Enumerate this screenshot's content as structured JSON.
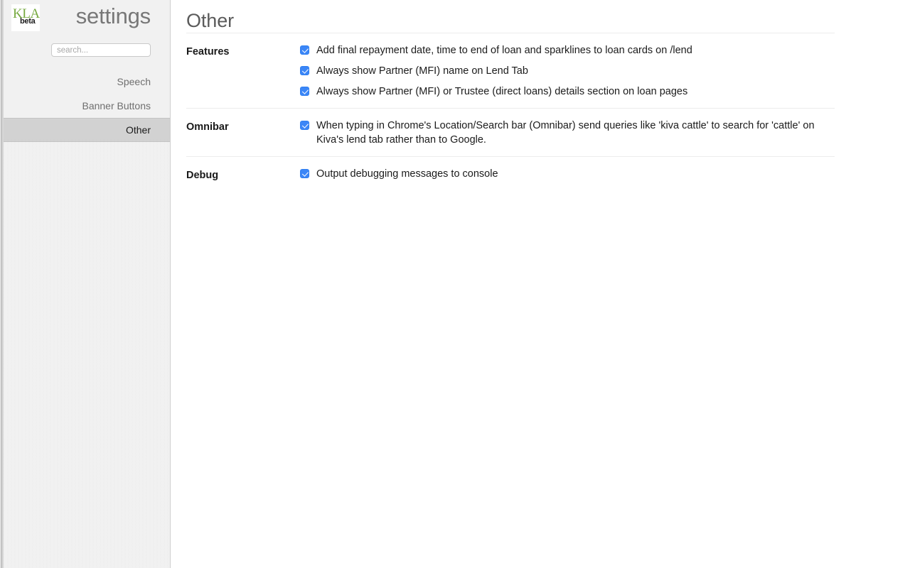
{
  "sidebar": {
    "logo": {
      "primary": "KLA",
      "suffix": "beta",
      "primary_color": "#76a93f"
    },
    "title": "settings",
    "search": {
      "value": "",
      "placeholder": "search..."
    },
    "items": [
      {
        "label": "Speech",
        "active": false
      },
      {
        "label": "Banner Buttons",
        "active": false
      },
      {
        "label": "Other",
        "active": true
      }
    ],
    "active_item_bg": "#d2d2d2"
  },
  "main": {
    "page_title": "Other",
    "accent_checkbox_color": "#3b86f7",
    "sections": [
      {
        "label": "Features",
        "options": [
          {
            "label": "Add final repayment date, time to end of loan and sparklines to loan cards on /lend",
            "checked": true
          },
          {
            "label": "Always show Partner (MFI) name on Lend Tab",
            "checked": true
          },
          {
            "label": "Always show Partner (MFI) or Trustee (direct loans) details section on loan pages",
            "checked": true
          }
        ]
      },
      {
        "label": "Omnibar",
        "options": [
          {
            "label": "When typing in Chrome's Location/Search bar (Omnibar) send queries like 'kiva cattle' to search for 'cattle' on Kiva's lend tab rather than to Google.",
            "checked": true
          }
        ]
      },
      {
        "label": "Debug",
        "options": [
          {
            "label": "Output debugging messages to console",
            "checked": true
          }
        ]
      }
    ]
  }
}
